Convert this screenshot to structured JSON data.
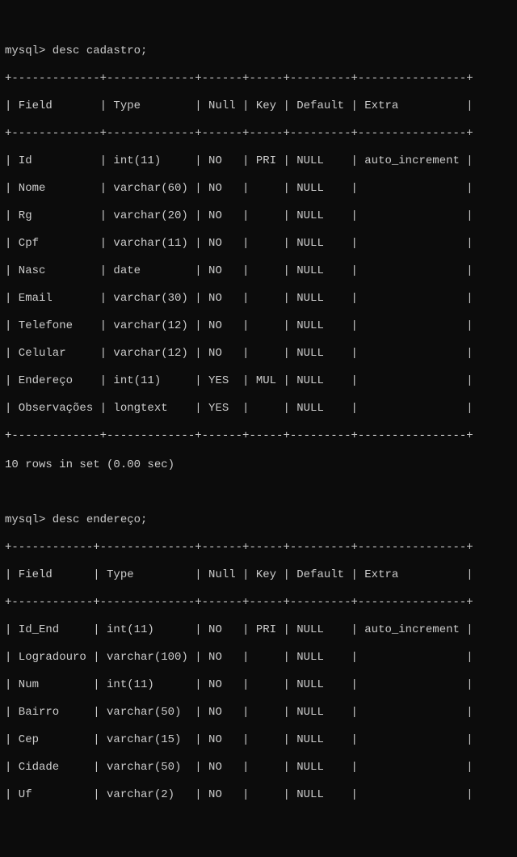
{
  "prompt1": "mysql> desc cadastro;",
  "table1": {
    "sep": "+-------------+-------------+------+-----+---------+----------------+",
    "hdr": "| Field       | Type        | Null | Key | Default | Extra          |",
    "rows": [
      "| Id          | int(11)     | NO   | PRI | NULL    | auto_increment |",
      "| Nome        | varchar(60) | NO   |     | NULL    |                |",
      "| Rg          | varchar(20) | NO   |     | NULL    |                |",
      "| Cpf         | varchar(11) | NO   |     | NULL    |                |",
      "| Nasc        | date        | NO   |     | NULL    |                |",
      "| Email       | varchar(30) | NO   |     | NULL    |                |",
      "| Telefone    | varchar(12) | NO   |     | NULL    |                |",
      "| Celular     | varchar(12) | NO   |     | NULL    |                |",
      "| Endereço    | int(11)     | YES  | MUL | NULL    |                |",
      "| Observações | longtext    | YES  |     | NULL    |                |"
    ]
  },
  "status1": "10 rows in set (0.00 sec)",
  "prompt2": "mysql> desc endereço;",
  "table2": {
    "sep": "+------------+--------------+------+-----+---------+----------------+",
    "hdr": "| Field      | Type         | Null | Key | Default | Extra          |",
    "rows": [
      "| Id_End     | int(11)      | NO   | PRI | NULL    | auto_increment |",
      "| Logradouro | varchar(100) | NO   |     | NULL    |                |",
      "| Num        | int(11)      | NO   |     | NULL    |                |",
      "| Bairro     | varchar(50)  | NO   |     | NULL    |                |",
      "| Cep        | varchar(15)  | NO   |     | NULL    |                |",
      "| Cidade     | varchar(50)  | NO   |     | NULL    |                |",
      "| Uf         | varchar(2)   | NO   |     | NULL    |                |"
    ]
  }
}
